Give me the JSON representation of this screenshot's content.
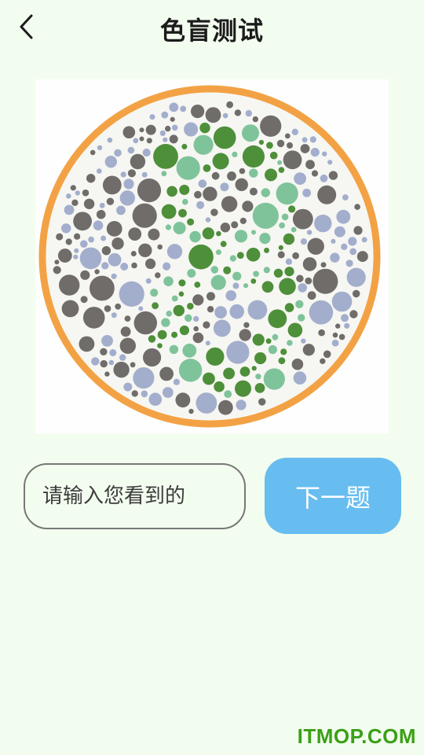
{
  "header": {
    "title": "色盲测试",
    "back_icon": "chevron-left-icon"
  },
  "plate": {
    "colors": {
      "ring": "#f2a245",
      "figure_dark": "#4e8f3a",
      "figure_light": "#7fc39a",
      "background_gray": "#6f6c69",
      "background_blue": "#a3aecd"
    }
  },
  "answer": {
    "placeholder": "请输入您看到的",
    "value": ""
  },
  "next_button": {
    "label": "下一题",
    "color": "#67bdf0"
  },
  "watermark": {
    "text": "ITMOP.COM"
  }
}
